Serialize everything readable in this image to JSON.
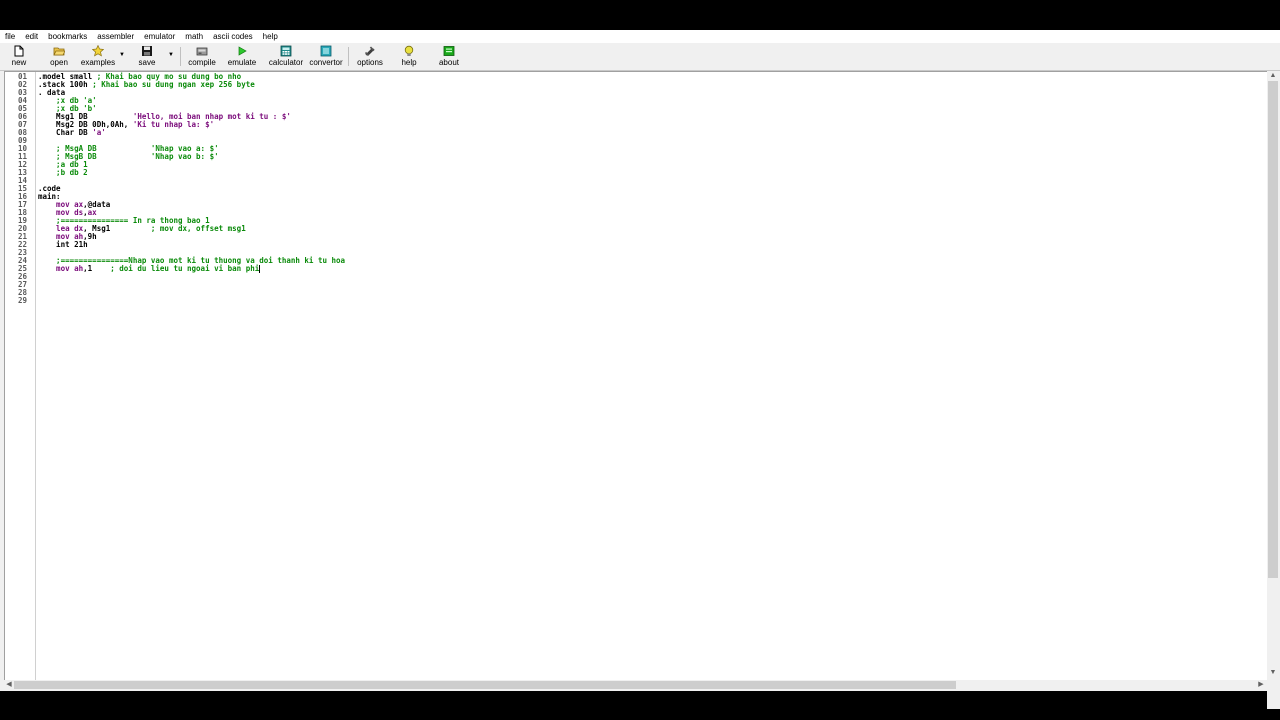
{
  "menu": [
    "file",
    "edit",
    "bookmarks",
    "assembler",
    "emulator",
    "math",
    "ascii codes",
    "help"
  ],
  "toolbar": {
    "new": "new",
    "open": "open",
    "examples": "examples",
    "save": "save",
    "compile": "compile",
    "emulate": "emulate",
    "calculator": "calculator",
    "convertor": "convertor",
    "options": "options",
    "help": "help",
    "about": "about"
  },
  "colors": {
    "keyword": "#7a0a7a",
    "comment": "#0a8a0a",
    "plain": "#000000",
    "line_number": "#5a5a5a"
  },
  "icons": {
    "new": "new-file-icon",
    "open": "open-folder-icon",
    "examples": "star-icon",
    "save": "floppy-disk-icon",
    "compile": "compile-icon",
    "emulate": "play-icon",
    "calculator": "calculator-icon",
    "convertor": "convertor-icon",
    "options": "tools-icon",
    "help": "lightbulb-icon",
    "about": "about-icon"
  },
  "editor": {
    "line_numbers": [
      "01",
      "02",
      "03",
      "04",
      "05",
      "06",
      "07",
      "08",
      "09",
      "10",
      "11",
      "12",
      "13",
      "14",
      "15",
      "16",
      "17",
      "18",
      "19",
      "20",
      "21",
      "22",
      "23",
      "24",
      "25",
      "26",
      "27",
      "28",
      "29"
    ],
    "lines": [
      [
        {
          "t": ".model small ",
          "c": "plain"
        },
        {
          "t": "; Khai bao quy mo su dung bo nho",
          "c": "com"
        }
      ],
      [
        {
          "t": ".stack 100h ",
          "c": "plain"
        },
        {
          "t": "; Khai bao su dung ngan xep 256 byte",
          "c": "com"
        }
      ],
      [
        {
          "t": ". data",
          "c": "plain"
        }
      ],
      [
        {
          "t": "    ;x db 'a'",
          "c": "com"
        }
      ],
      [
        {
          "t": "    ;x db 'b'",
          "c": "com"
        }
      ],
      [
        {
          "t": "    Msg1 DB          ",
          "c": "plain"
        },
        {
          "t": "'Hello, moi ban nhap mot ki tu : $'",
          "c": "str"
        }
      ],
      [
        {
          "t": "    Msg2 DB 0Dh,0Ah, ",
          "c": "plain"
        },
        {
          "t": "'Ki tu nhap la: $'",
          "c": "str"
        }
      ],
      [
        {
          "t": "    Char DB ",
          "c": "plain"
        },
        {
          "t": "'a'",
          "c": "str"
        }
      ],
      [],
      [
        {
          "t": "    ; MsgA DB            'Nhap vao a: $'",
          "c": "com"
        }
      ],
      [
        {
          "t": "    ; MsgB DB            'Nhap vao b: $'",
          "c": "com"
        }
      ],
      [
        {
          "t": "    ;a db 1",
          "c": "com"
        }
      ],
      [
        {
          "t": "    ;b db 2",
          "c": "com"
        }
      ],
      [],
      [
        {
          "t": ".code",
          "c": "plain"
        }
      ],
      [
        {
          "t": "main:",
          "c": "plain"
        }
      ],
      [
        {
          "t": "    mov ",
          "c": "kw"
        },
        {
          "t": "ax",
          "c": "kw"
        },
        {
          "t": ",@data",
          "c": "plain"
        }
      ],
      [
        {
          "t": "    mov ",
          "c": "kw"
        },
        {
          "t": "ds",
          "c": "kw"
        },
        {
          "t": ",",
          "c": "plain"
        },
        {
          "t": "ax",
          "c": "kw"
        }
      ],
      [
        {
          "t": "    ;=============== In ra thong bao 1",
          "c": "com"
        }
      ],
      [
        {
          "t": "    lea ",
          "c": "kw"
        },
        {
          "t": "dx",
          "c": "kw"
        },
        {
          "t": ", Msg1         ",
          "c": "plain"
        },
        {
          "t": "; mov dx, offset msg1",
          "c": "com"
        }
      ],
      [
        {
          "t": "    mov ",
          "c": "kw"
        },
        {
          "t": "ah",
          "c": "kw"
        },
        {
          "t": ",9h",
          "c": "plain"
        }
      ],
      [
        {
          "t": "    int 21h",
          "c": "plain"
        }
      ],
      [],
      [
        {
          "t": "    ;===============Nhap vao mot ki tu thuong va doi thanh ki tu hoa",
          "c": "com"
        }
      ],
      [
        {
          "t": "    mov ",
          "c": "kw"
        },
        {
          "t": "ah",
          "c": "kw"
        },
        {
          "t": ",1    ",
          "c": "plain"
        },
        {
          "t": "; doi du lieu tu ngoai vi ban phi",
          "c": "com"
        }
      ],
      [],
      [],
      [],
      []
    ],
    "caret_line": 25
  }
}
